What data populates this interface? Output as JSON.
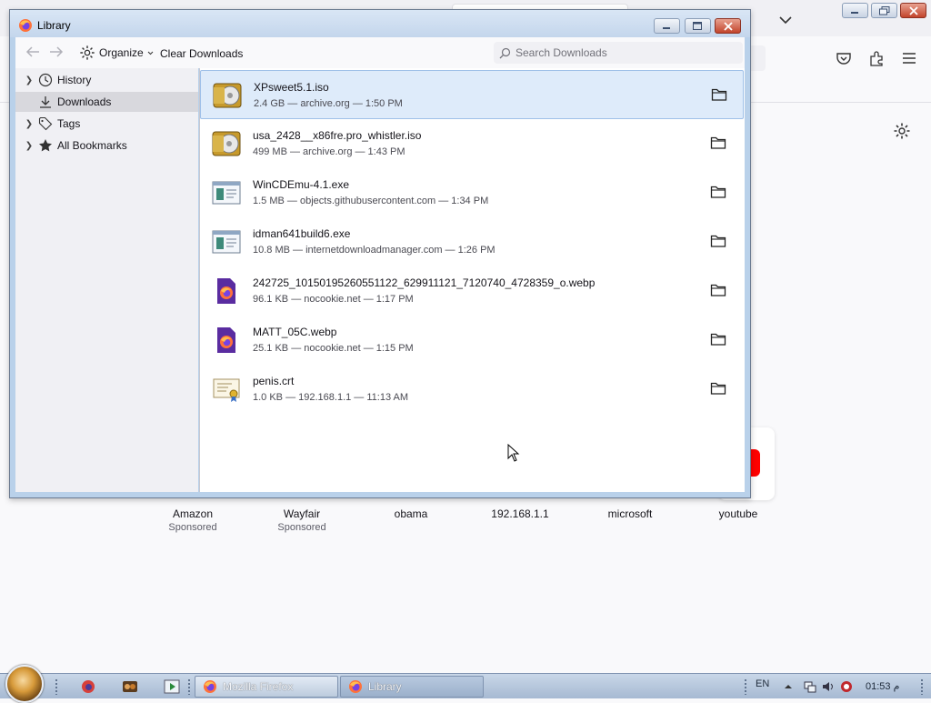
{
  "colors": {
    "accent": "#0061e0",
    "selection": "#deebfa",
    "sidebar_bg": "#f0f0f4",
    "youtube_red": "#ff0000"
  },
  "background_browser": {
    "toolbar_icons": [
      "pocket-icon",
      "extensions-icon",
      "menu-icon"
    ],
    "settings_icon": "gear-icon",
    "top_sites": [
      {
        "name": "Amazon",
        "sponsored": "Sponsored"
      },
      {
        "name": "Wayfair",
        "sponsored": "Sponsored"
      },
      {
        "name": "obama",
        "sponsored": ""
      },
      {
        "name": "192.168.1.1",
        "sponsored": ""
      },
      {
        "name": "microsoft",
        "sponsored": ""
      },
      {
        "name": "youtube",
        "sponsored": ""
      }
    ]
  },
  "library": {
    "title": "Library",
    "toolbar": {
      "organize_label": "Organize",
      "clear_label": "Clear Downloads",
      "search_placeholder": "Search Downloads"
    },
    "sidebar": [
      {
        "label": "History",
        "icon": "clock-icon",
        "expandable": true
      },
      {
        "label": "Downloads",
        "icon": "download-icon",
        "expandable": false,
        "selected": true
      },
      {
        "label": "Tags",
        "icon": "tag-icon",
        "expandable": true
      },
      {
        "label": "All Bookmarks",
        "icon": "star-icon",
        "expandable": true
      }
    ],
    "downloads": [
      {
        "name": "XPsweet5.1.iso",
        "meta": "2.4 GB — archive.org — 1:50 PM",
        "icon": "disc-image-icon",
        "selected": true
      },
      {
        "name": "usa_2428__x86fre.pro_whistler.iso",
        "meta": "499 MB — archive.org — 1:43 PM",
        "icon": "disc-image-icon"
      },
      {
        "name": "WinCDEmu-4.1.exe",
        "meta": "1.5 MB — objects.githubusercontent.com — 1:34 PM",
        "icon": "executable-icon"
      },
      {
        "name": "idman641build6.exe",
        "meta": "10.8 MB — internetdownloadmanager.com — 1:26 PM",
        "icon": "executable-icon"
      },
      {
        "name": "242725_10150195260551122_629911121_7120740_4728359_o.webp",
        "meta": "96.1 KB — nocookie.net — 1:17 PM",
        "icon": "firefox-document-icon"
      },
      {
        "name": "MATT_05C.webp",
        "meta": "25.1 KB — nocookie.net — 1:15 PM",
        "icon": "firefox-document-icon"
      },
      {
        "name": "penis.crt",
        "meta": "1.0 KB — 192.168.1.1 — 11:13 AM",
        "icon": "certificate-icon"
      }
    ]
  },
  "taskbar": {
    "buttons": [
      {
        "label": "Mozilla Firefox",
        "icon": "firefox-icon"
      },
      {
        "label": "Library",
        "icon": "firefox-icon",
        "active": true
      }
    ],
    "language": "EN",
    "clock": "01:53 م"
  }
}
